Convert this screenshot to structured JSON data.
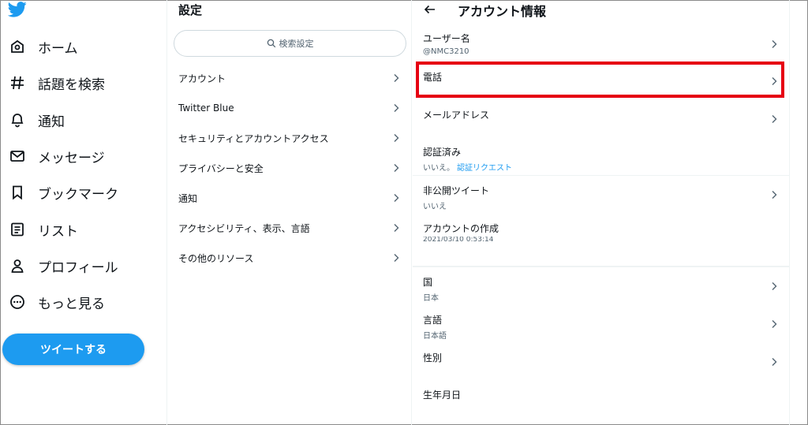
{
  "nav": {
    "items": [
      {
        "label": "ホーム",
        "icon": "home-icon"
      },
      {
        "label": "話題を検索",
        "icon": "hashtag-icon"
      },
      {
        "label": "通知",
        "icon": "bell-icon"
      },
      {
        "label": "メッセージ",
        "icon": "mail-icon"
      },
      {
        "label": "ブックマーク",
        "icon": "bookmark-icon"
      },
      {
        "label": "リスト",
        "icon": "list-icon"
      },
      {
        "label": "プロフィール",
        "icon": "person-icon"
      },
      {
        "label": "もっと見る",
        "icon": "more-circle-icon"
      }
    ],
    "tweet_button": "ツイートする"
  },
  "settings": {
    "title": "設定",
    "search_placeholder": "検索設定",
    "items": [
      {
        "label": "アカウント"
      },
      {
        "label": "Twitter Blue"
      },
      {
        "label": "セキュリティとアカウントアクセス"
      },
      {
        "label": "プライバシーと安全"
      },
      {
        "label": "通知"
      },
      {
        "label": "アクセシビリティ、表示、言語"
      },
      {
        "label": "その他のリソース"
      }
    ]
  },
  "account": {
    "title": "アカウント情報",
    "username": {
      "label": "ユーザー名",
      "value": "@NMC3210"
    },
    "phone": {
      "label": "電話"
    },
    "email": {
      "label": "メールアドレス"
    },
    "verified": {
      "label": "認証済み",
      "value": "いいえ。",
      "link": "認証リクエスト"
    },
    "protected": {
      "label": "非公開ツイート",
      "value": "いいえ"
    },
    "created": {
      "label": "アカウントの作成",
      "value": "2021/03/10 0:53:14"
    },
    "country": {
      "label": "国",
      "value": "日本"
    },
    "language": {
      "label": "言語",
      "value": "日本語"
    },
    "gender": {
      "label": "性別"
    },
    "birthdate": {
      "label": "生年月日"
    }
  },
  "colors": {
    "accent": "#1d9bf0",
    "highlight": "#e60012"
  }
}
